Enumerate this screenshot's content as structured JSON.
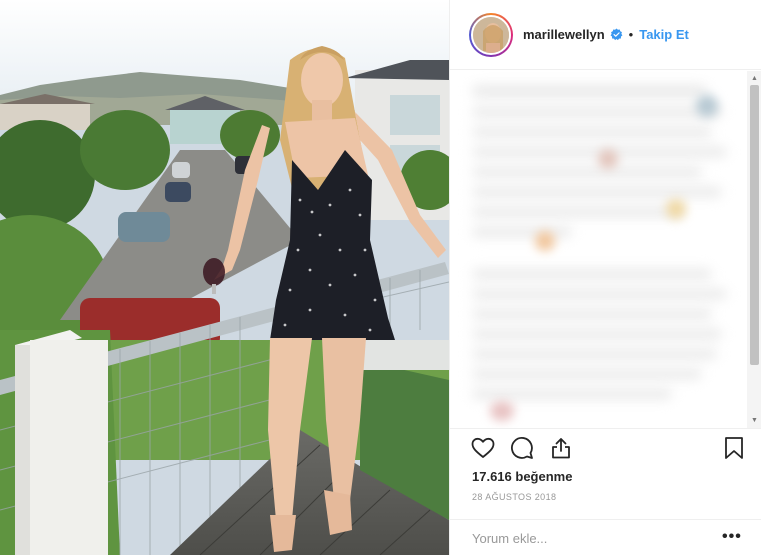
{
  "post": {
    "username": "marillewellyn",
    "verified": true,
    "separator": "•",
    "follow_label": "Takip Et",
    "likes_text": "17.616 beğenme",
    "date_text": "28 AĞUSTOS 2018",
    "comment_placeholder": "Yorum ekle...",
    "more_label": "•••"
  },
  "icons": {
    "like": "heart-icon",
    "comment": "comment-bubble-icon",
    "share": "share-icon",
    "save": "bookmark-icon",
    "verified": "verified-badge-icon"
  },
  "colors": {
    "accent": "#3897f0",
    "text": "#262626",
    "muted": "#999999",
    "border": "#efefef"
  }
}
